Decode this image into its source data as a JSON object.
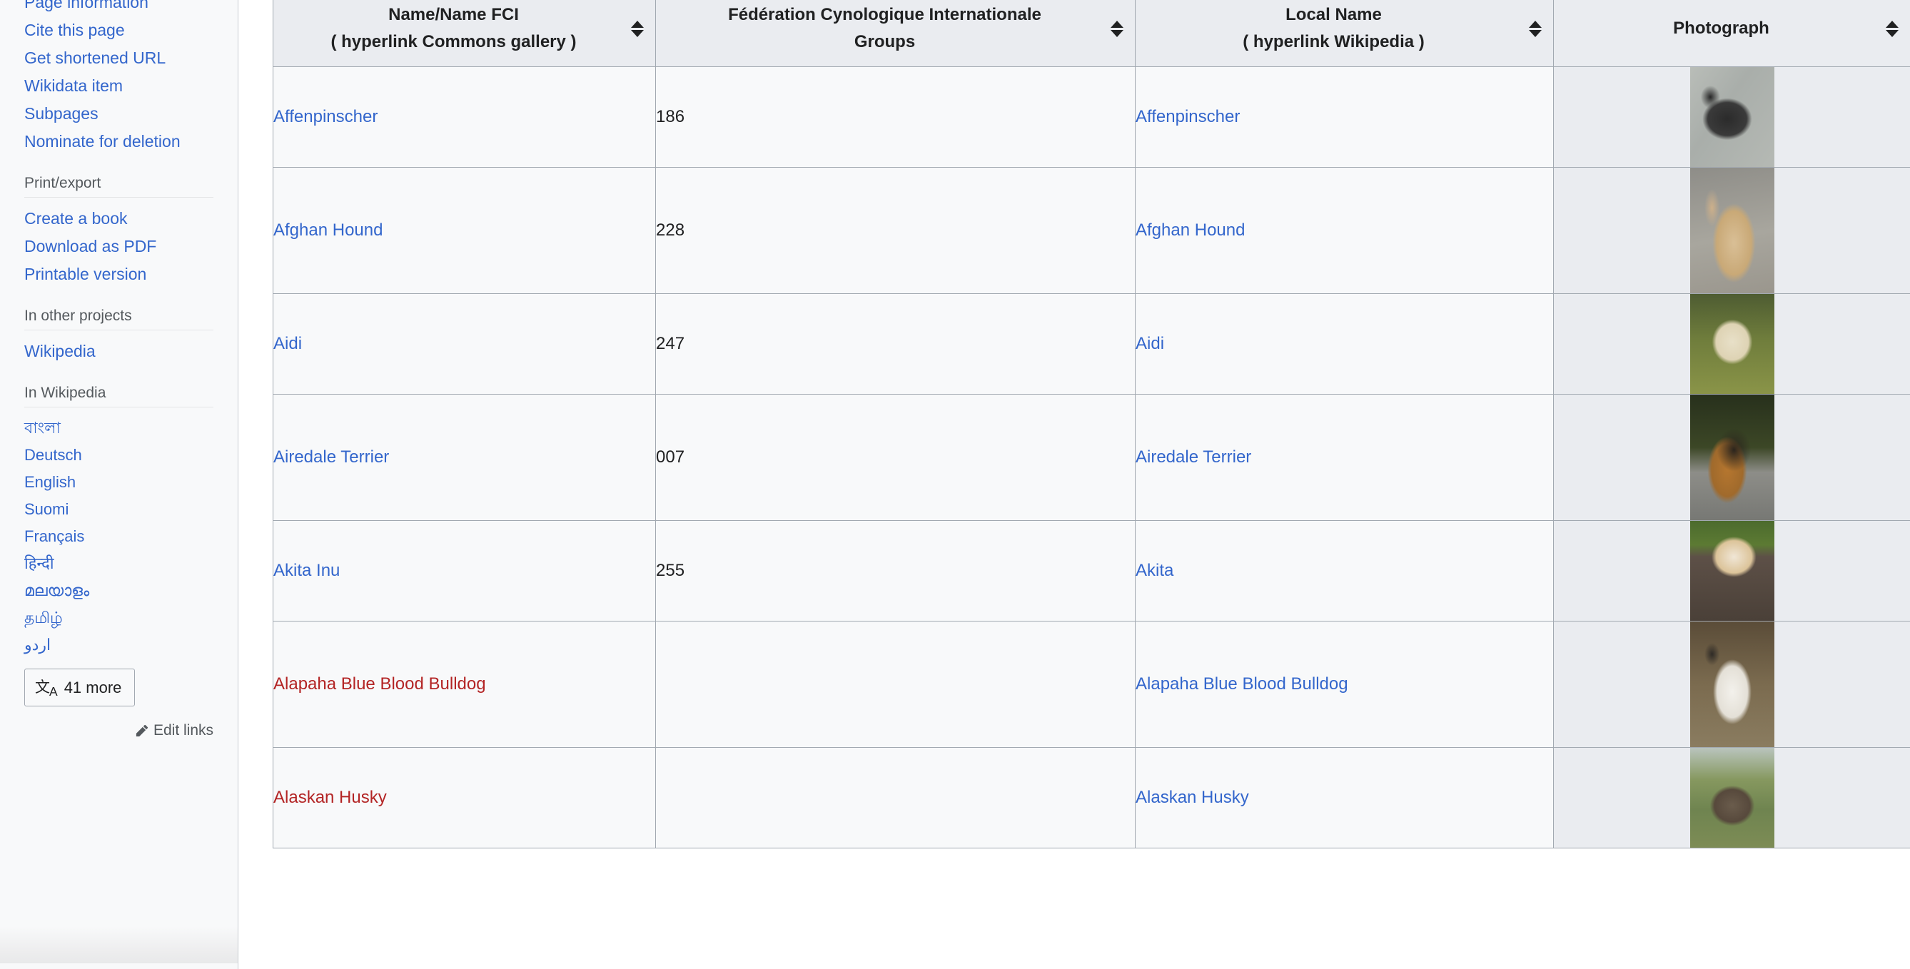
{
  "sidebar": {
    "tools_links": [
      "Page information",
      "Cite this page",
      "Get shortened URL",
      "Wikidata item",
      "Subpages",
      "Nominate for deletion"
    ],
    "print_export_heading": "Print/export",
    "print_export_links": [
      "Create a book",
      "Download as PDF",
      "Printable version"
    ],
    "other_projects_heading": "In other projects",
    "other_projects_links": [
      "Wikipedia"
    ],
    "in_wikipedia_heading": "In Wikipedia",
    "languages": [
      "বাংলা",
      "Deutsch",
      "English",
      "Suomi",
      "Français",
      "हिन्दी",
      "മലയാളം",
      "தமிழ்",
      "اردو"
    ],
    "more_button": {
      "icon": "language-translate-icon",
      "label": "41 more"
    },
    "edit_links": {
      "icon": "pencil-icon",
      "label": "Edit links"
    }
  },
  "table": {
    "headers": [
      {
        "line1": "Name/Name FCI",
        "line2": "( hyperlink Commons gallery )",
        "sortable": true,
        "style": "dark"
      },
      {
        "line1": "Fédération Cynologique Internationale",
        "line2": "Groups",
        "sortable": true,
        "style": "link"
      },
      {
        "line1": "Local Name",
        "line2": "( hyperlink Wikipedia )",
        "sortable": true,
        "style": "dark"
      },
      {
        "line1": "Photograph",
        "line2": "",
        "sortable": true,
        "style": "dark"
      }
    ],
    "rows": [
      {
        "name": "Affenpinscher",
        "name_state": "blue",
        "fci": "186",
        "local": "Affenpinscher",
        "local_state": "blue",
        "photo": "affenpinscher-photo",
        "photo_class": "dog-affen",
        "photo_size": "med"
      },
      {
        "name": "Afghan Hound",
        "name_state": "blue",
        "fci": "228",
        "local": "Afghan Hound",
        "local_state": "blue",
        "photo": "afghan-hound-photo",
        "photo_class": "dog-afghan",
        "photo_size": "tall"
      },
      {
        "name": "Aidi",
        "name_state": "blue",
        "fci": "247",
        "local": "Aidi",
        "local_state": "blue",
        "photo": "aidi-photo",
        "photo_class": "dog-aidi",
        "photo_size": "med"
      },
      {
        "name": "Airedale Terrier",
        "name_state": "blue",
        "fci": "007",
        "local": "Airedale Terrier",
        "local_state": "blue",
        "photo": "airedale-terrier-photo",
        "photo_class": "dog-airedale",
        "photo_size": "tall"
      },
      {
        "name": "Akita Inu",
        "name_state": "blue",
        "fci": "255",
        "local": "Akita",
        "local_state": "blue",
        "photo": "akita-photo",
        "photo_class": "dog-akita",
        "photo_size": "med"
      },
      {
        "name": "Alapaha Blue Blood Bulldog",
        "name_state": "red",
        "fci": "",
        "local": "Alapaha Blue Blood Bulldog",
        "local_state": "blue",
        "photo": "alapaha-blue-blood-bulldog-photo",
        "photo_class": "dog-alapaha",
        "photo_size": "tall"
      },
      {
        "name": "Alaskan Husky",
        "name_state": "red",
        "fci": "",
        "local": "Alaskan Husky",
        "local_state": "blue",
        "photo": "alaskan-husky-photo",
        "photo_class": "dog-alaskan",
        "photo_size": "med"
      }
    ]
  },
  "colors": {
    "link_blue": "#3366cc",
    "link_red": "#b32424",
    "table_header_bg": "#eaecf0",
    "table_border": "#a2a9b1",
    "sidebar_bg": "#f8f9fa"
  }
}
